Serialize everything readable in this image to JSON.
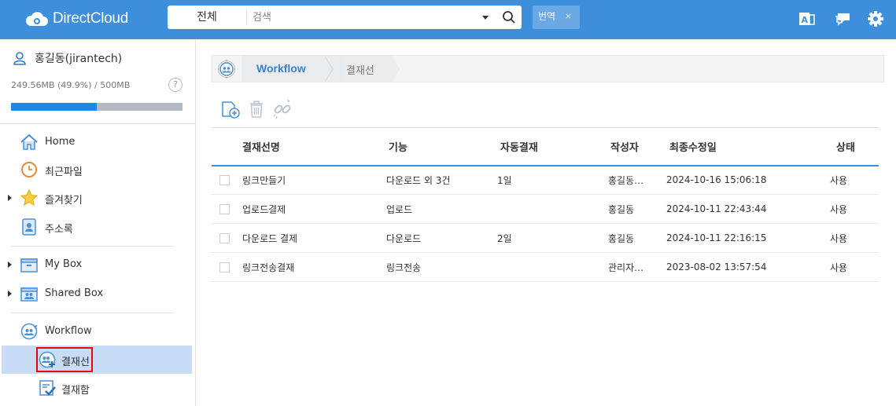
{
  "app": {
    "logo_text": "DirectCloud"
  },
  "search": {
    "scope": "전체",
    "placeholder": "검색",
    "tag_label": "번역",
    "tag_close": "×"
  },
  "user": {
    "name": "홍길동(jirantech)",
    "quota_text": "249.56MB (49.9%) / 500MB",
    "quota_fraction": 0.499,
    "help": "?"
  },
  "sidebar": {
    "items": [
      {
        "label": "Home"
      },
      {
        "label": "최근파일"
      },
      {
        "label": "즐겨찾기"
      },
      {
        "label": "주소록"
      },
      {
        "label": "My Box"
      },
      {
        "label": "Shared Box"
      },
      {
        "label": "Workflow"
      },
      {
        "label": "결재선"
      },
      {
        "label": "결재함"
      }
    ]
  },
  "breadcrumb": {
    "root": "Workflow",
    "current": "결재선"
  },
  "table": {
    "headers": [
      "결재선명",
      "기능",
      "자동결재",
      "작성자",
      "최종수정일",
      "상태"
    ],
    "rows": [
      [
        "링크만들기",
        "다운로드 외 3건",
        "1일",
        "홍길동…",
        "2024-10-16 15:06:18",
        "사용"
      ],
      [
        "업로드결제",
        "업로드",
        "",
        "홍길동",
        "2024-10-11 22:43:44",
        "사용"
      ],
      [
        "다운로드 결제",
        "다운로드",
        "2일",
        "홍길동",
        "2024-10-11 22:16:15",
        "사용"
      ],
      [
        "링크전송결재",
        "링크전송",
        "",
        "관리자…",
        "2023-08-02 13:57:54",
        "사용"
      ]
    ]
  },
  "colors": {
    "topbar": "#3d8fdc",
    "accent": "#3d7fc9",
    "selected": "#c8dcf6",
    "highlight": "#ee0000"
  }
}
